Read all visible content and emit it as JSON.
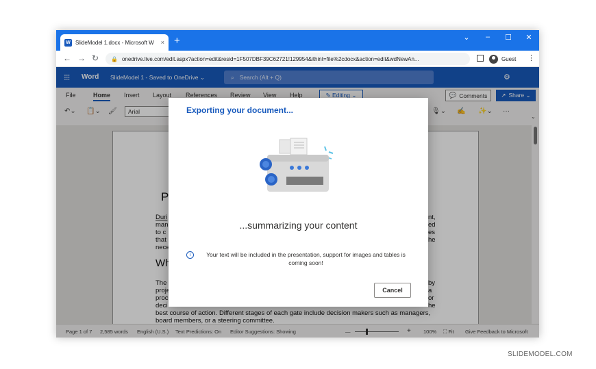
{
  "browser": {
    "tab_title": "SlideModel 1.docx - Microsoft W",
    "tab_close": "×",
    "new_tab": "+",
    "url": "onedrive.live.com/edit.aspx?action=edit&resid=1F507DBF39C62721!129954&ithint=file%2cdocx&action=edit&wdNewAn...",
    "profile": "Guest",
    "controls": {
      "dropdown": "⌄",
      "minimize": "–",
      "maximize": "☐",
      "close": "✕"
    },
    "nav": {
      "back": "←",
      "forward": "→",
      "reload": "↻"
    },
    "menu": "⋮"
  },
  "word": {
    "app_name": "Word",
    "doc_title": "SlideModel 1 - Saved to OneDrive ⌄",
    "search_placeholder": "Search (Alt + Q)",
    "ribbon_tabs": [
      "File",
      "Home",
      "Insert",
      "Layout",
      "References",
      "Review",
      "View",
      "Help"
    ],
    "editing": "✎ Editing ⌄",
    "comments": "Comments",
    "share": "Share ⌄",
    "font": "Arial"
  },
  "document": {
    "heading1": "P",
    "para1_lines": [
      "Duri",
      "man",
      "to c",
      "that",
      "nece"
    ],
    "para1_right": [
      "nt,",
      "ed",
      "es",
      "he",
      ""
    ],
    "heading2": "Wh",
    "para2_lines": [
      "The",
      "proje",
      "proc",
      "deci"
    ],
    "para2_right": [
      "by",
      "a",
      "or",
      "he"
    ],
    "para2_end": [
      "best course of action. Different stages of each gate include decision makers such as managers,",
      "board members, or a steering committee."
    ]
  },
  "statusbar": {
    "page": "Page 1 of 7",
    "words": "2,585 words",
    "language": "English (U.S.)",
    "predictions": "Text Predictions: On",
    "suggestions": "Editor Suggestions: Showing",
    "zoom": "100%",
    "fit": "Fit",
    "feedback": "Give Feedback to Microsoft"
  },
  "dialog": {
    "title": "Exporting your document...",
    "status": "...summarizing your content",
    "info": "Your text will be included in the presentation, support for images and tables is coming soon!",
    "cancel": "Cancel"
  },
  "watermark": "SLIDEMODEL.COM",
  "colors": {
    "word_blue": "#185abd",
    "chrome_blue": "#1a73e8"
  }
}
